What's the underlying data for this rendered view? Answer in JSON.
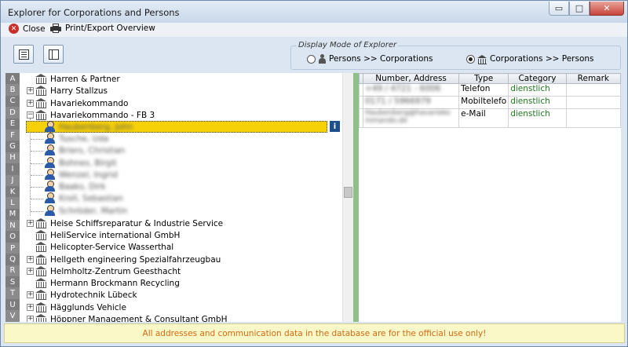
{
  "window": {
    "title": "Explorer for Corporations and Persons",
    "minimize": "▭",
    "maximize": "□",
    "close": "✕"
  },
  "menu": {
    "close_label": "Close",
    "print_label": "Print/Export Overview"
  },
  "display_mode": {
    "label": "Display Mode of Explorer",
    "option1": "Persons >> Corporations",
    "option2": "Corporations >> Persons",
    "selected": "option2"
  },
  "alphabet": [
    "A",
    "B",
    "C",
    "D",
    "E",
    "F",
    "G",
    "H",
    "I",
    "J",
    "K",
    "L",
    "M",
    "N",
    "O",
    "P",
    "Q",
    "R",
    "S",
    "T",
    "U",
    "V"
  ],
  "tree": {
    "items": [
      {
        "label": "Harren & Partner",
        "expander": "",
        "kind": "corp"
      },
      {
        "label": "Harry Stallzus",
        "expander": "+",
        "kind": "corp"
      },
      {
        "label": "Havariekommando",
        "expander": "+",
        "kind": "corp"
      },
      {
        "label": "Havariekommando - FB 3",
        "expander": "−",
        "kind": "corp"
      },
      {
        "label": "Haubenberg, John",
        "kind": "person"
      },
      {
        "label": "Tusche, Uda",
        "kind": "person"
      },
      {
        "label": "Briers, Christian",
        "kind": "person"
      },
      {
        "label": "Bohnes, Birgit",
        "kind": "person"
      },
      {
        "label": "Wenzel, Ingrid",
        "kind": "person"
      },
      {
        "label": "Baaks, Dirk",
        "kind": "person"
      },
      {
        "label": "Kroll, Sebastian",
        "kind": "person"
      },
      {
        "label": "Schröder, Martin",
        "kind": "person"
      },
      {
        "label": "Heise Schiffsreparatur & Industrie Service",
        "expander": "+",
        "kind": "corp"
      },
      {
        "label": "HeliService international GmbH",
        "expander": "",
        "kind": "corp"
      },
      {
        "label": "Helicopter-Service Wasserthal",
        "expander": "",
        "kind": "corp"
      },
      {
        "label": "Hellgeth engineering  Spezialfahrzeugbau",
        "expander": "+",
        "kind": "corp"
      },
      {
        "label": "Helmholtz-Zentrum Geesthacht",
        "expander": "+",
        "kind": "corp"
      },
      {
        "label": "Hermann Brockmann Recycling",
        "expander": "",
        "kind": "corp"
      },
      {
        "label": "Hydrotechnik Lübeck",
        "expander": "+",
        "kind": "corp"
      },
      {
        "label": "Hägglunds Vehicle",
        "expander": "+",
        "kind": "corp"
      },
      {
        "label": "Höppner Management & Consultant GmbH",
        "expander": "+",
        "kind": "corp"
      }
    ],
    "info_button": "i"
  },
  "contacts": {
    "headers": [
      "Number, Address",
      "Type",
      "Category",
      "Remark"
    ],
    "rows": [
      {
        "number": "+49 / 4721 - 6006",
        "type": "Telefon",
        "category": "dienstlich",
        "remark": ""
      },
      {
        "number": "0171 / 5966979",
        "type": "Mobiltelefo",
        "category": "dienstlich",
        "remark": ""
      },
      {
        "number": "Haubenberg@havariekommando.de",
        "type": "e-Mail",
        "category": "dienstlich",
        "remark": ""
      }
    ]
  },
  "status": "All addresses and communication data in the database are for the official use only!"
}
